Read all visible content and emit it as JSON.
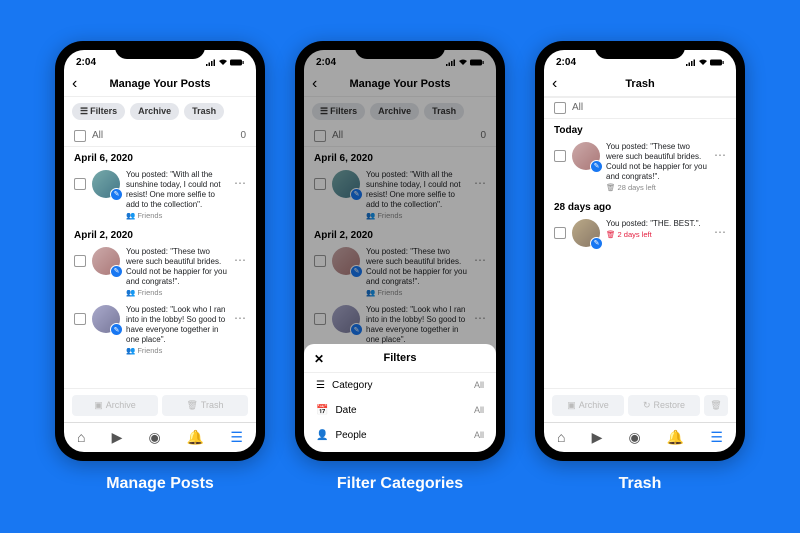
{
  "status_time": "2:04",
  "captions": [
    "Manage Posts",
    "Filter Categories",
    "Trash"
  ],
  "phone1": {
    "title": "Manage Your Posts",
    "chips": {
      "filters": "Filters",
      "archive": "Archive",
      "trash": "Trash"
    },
    "all_label": "All",
    "all_count": "0",
    "groups": [
      {
        "date": "April 6, 2020",
        "posts": [
          {
            "text": "You posted: \"With all the sunshine today, I could not resist! One more selfie to add to the collection\".",
            "meta": "Friends"
          }
        ]
      },
      {
        "date": "April 2, 2020",
        "posts": [
          {
            "text": "You posted: \"These two were such beautiful brides. Could not be happier for you and congrats!\".",
            "meta": "Friends"
          },
          {
            "text": "You posted: \"Look who I ran into in the lobby! So good to have everyone together in one place\".",
            "meta": "Friends"
          }
        ]
      }
    ],
    "actions": {
      "archive": "Archive",
      "trash": "Trash"
    }
  },
  "phone2": {
    "title": "Manage Your Posts",
    "sheet": {
      "title": "Filters",
      "rows": [
        {
          "label": "Category",
          "value": "All"
        },
        {
          "label": "Date",
          "value": "All"
        },
        {
          "label": "People",
          "value": "All"
        }
      ]
    }
  },
  "phone3": {
    "title": "Trash",
    "all_label": "All",
    "groups": [
      {
        "date": "Today",
        "posts": [
          {
            "text": "You posted: \"These two were such beautiful brides. Could not be happier for you and congrats!\".",
            "meta": "28 days left",
            "danger": false
          }
        ]
      },
      {
        "date": "28 days ago",
        "posts": [
          {
            "text": "You posted: \"THE. BEST.\".",
            "meta": "2 days left",
            "danger": true
          }
        ]
      }
    ],
    "actions": {
      "archive": "Archive",
      "restore": "Restore"
    }
  }
}
